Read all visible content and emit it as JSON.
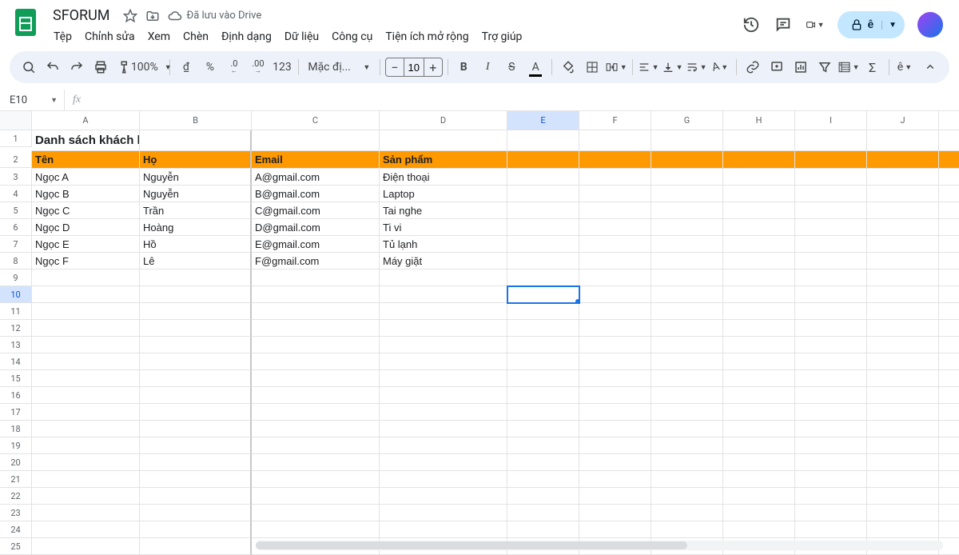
{
  "doc": {
    "title": "SFORUM",
    "drive_status": "Đã lưu vào Drive"
  },
  "menu": [
    "Tệp",
    "Chỉnh sửa",
    "Xem",
    "Chèn",
    "Định dạng",
    "Dữ liệu",
    "Công cụ",
    "Tiện ích mở rộng",
    "Trợ giúp"
  ],
  "toolbar": {
    "zoom": "100%",
    "currency": "₫",
    "percent": "%",
    "dec_less": ".0",
    "dec_more": ".00",
    "num_fmt": "123",
    "font": "Mặc đị...",
    "font_size": "10"
  },
  "namebox": "E10",
  "columns": [
    "A",
    "B",
    "C",
    "D",
    "E",
    "F",
    "G",
    "H",
    "I",
    "J"
  ],
  "active_col_index": 4,
  "row_count": 25,
  "active_row": 10,
  "title_cell": "Danh sách khách hàng",
  "headers": [
    "Tên",
    "Họ",
    "Email",
    "Sản phẩm"
  ],
  "rows": [
    {
      "ten": "Ngọc A",
      "ho": "Nguyễn",
      "email": "A@gmail.com",
      "sp": "Điện thoại"
    },
    {
      "ten": "Ngọc B",
      "ho": "Nguyễn",
      "email": "B@gmail.com",
      "sp": "Laptop"
    },
    {
      "ten": "Ngọc C",
      "ho": "Trần",
      "email": "C@gmail.com",
      "sp": "Tai nghe"
    },
    {
      "ten": "Ngọc D",
      "ho": "Hoàng",
      "email": "D@gmail.com",
      "sp": "Ti vi"
    },
    {
      "ten": "Ngọc E",
      "ho": "Hồ",
      "email": "E@gmail.com",
      "sp": "Tủ lạnh"
    },
    {
      "ten": "Ngọc F",
      "ho": "Lê",
      "email": "F@gmail.com",
      "sp": "Máy giặt"
    }
  ],
  "share_label": "ê"
}
